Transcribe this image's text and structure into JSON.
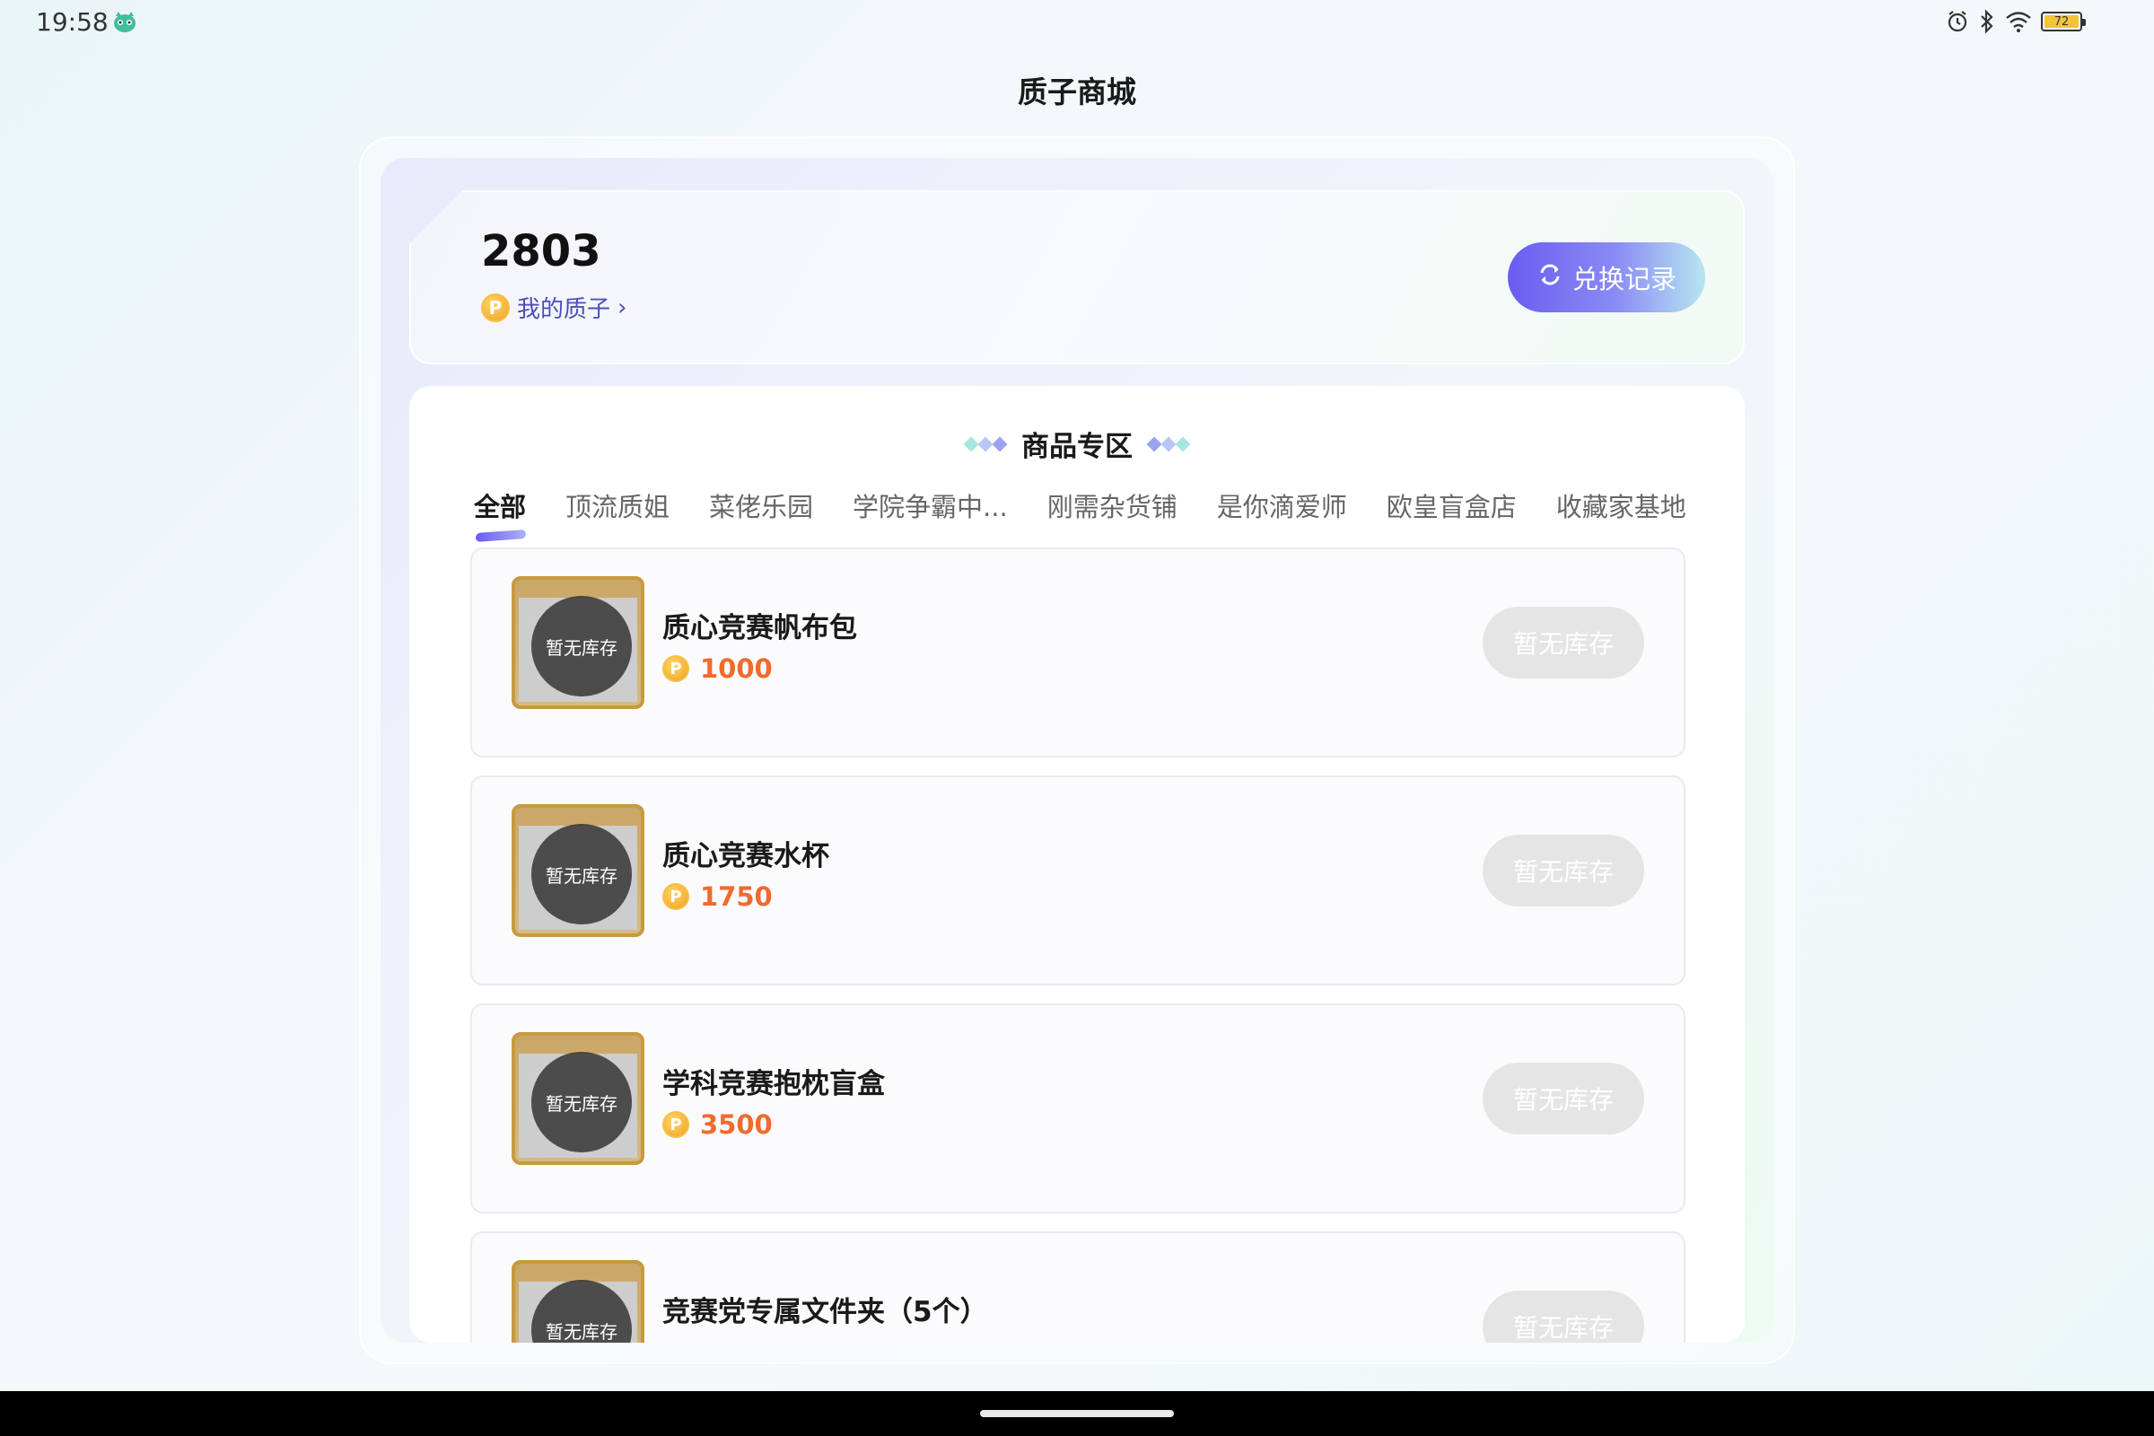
{
  "status_bar": {
    "time": "19:58",
    "battery_level": "72",
    "icons": [
      "app-mascot-icon",
      "alarm-icon",
      "bluetooth-icon",
      "wifi-icon",
      "battery-icon"
    ]
  },
  "page": {
    "title": "质子商城"
  },
  "balance": {
    "value": "2803",
    "my_coins_label": "我的质子",
    "coin_symbol": "P",
    "history_button": "兑换记录"
  },
  "products_section": {
    "title": "商品专区",
    "tabs": [
      {
        "label": "全部",
        "active": true
      },
      {
        "label": "顶流质姐",
        "active": false
      },
      {
        "label": "菜佬乐园",
        "active": false
      },
      {
        "label": "学院争霸中...",
        "active": false
      },
      {
        "label": "刚需杂货铺",
        "active": false
      },
      {
        "label": "是你滴爱师",
        "active": false
      },
      {
        "label": "欧皇盲盒店",
        "active": false
      },
      {
        "label": "收藏家基地",
        "active": false
      }
    ],
    "items": [
      {
        "name": "质心竞赛帆布包",
        "price": "1000",
        "stock_label": "暂无库存",
        "button_label": "暂无库存"
      },
      {
        "name": "质心竞赛水杯",
        "price": "1750",
        "stock_label": "暂无库存",
        "button_label": "暂无库存"
      },
      {
        "name": "学科竞赛抱枕盲盒",
        "price": "3500",
        "stock_label": "暂无库存",
        "button_label": "暂无库存"
      },
      {
        "name": "竞赛党专属文件夹（5个）",
        "price": "",
        "stock_label": "暂无库存",
        "button_label": "暂无库存"
      }
    ]
  },
  "colors": {
    "accent": "#6a5cf0",
    "price": "#f06a2e",
    "disabled_button": "#e5e5e5"
  }
}
